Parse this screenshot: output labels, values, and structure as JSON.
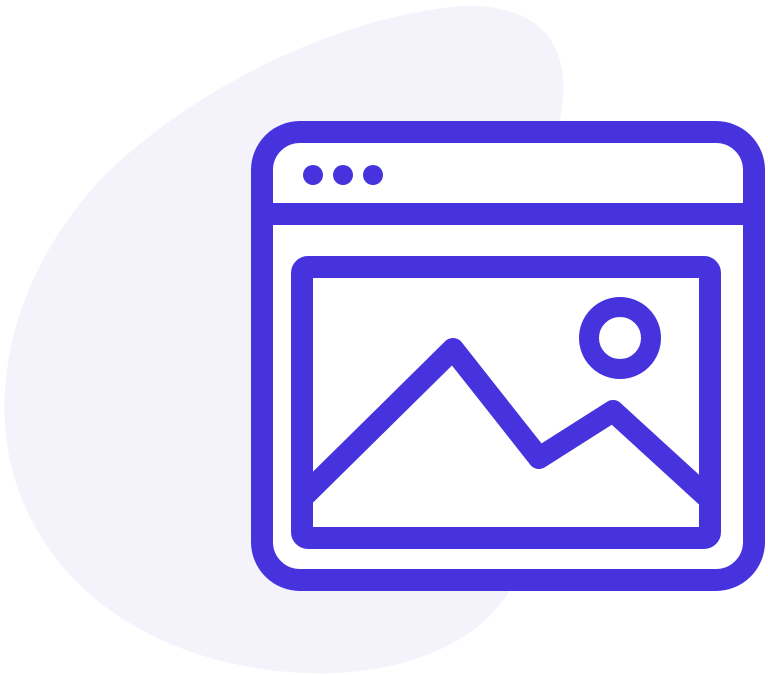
{
  "illustration": {
    "icon": "browser-image-icon",
    "colors": {
      "background": "#ffffff",
      "blob": "#f4f3fc",
      "stroke": "#4733de",
      "window_fill": "#ffffff"
    },
    "window_controls": [
      "dot",
      "dot",
      "dot"
    ]
  }
}
